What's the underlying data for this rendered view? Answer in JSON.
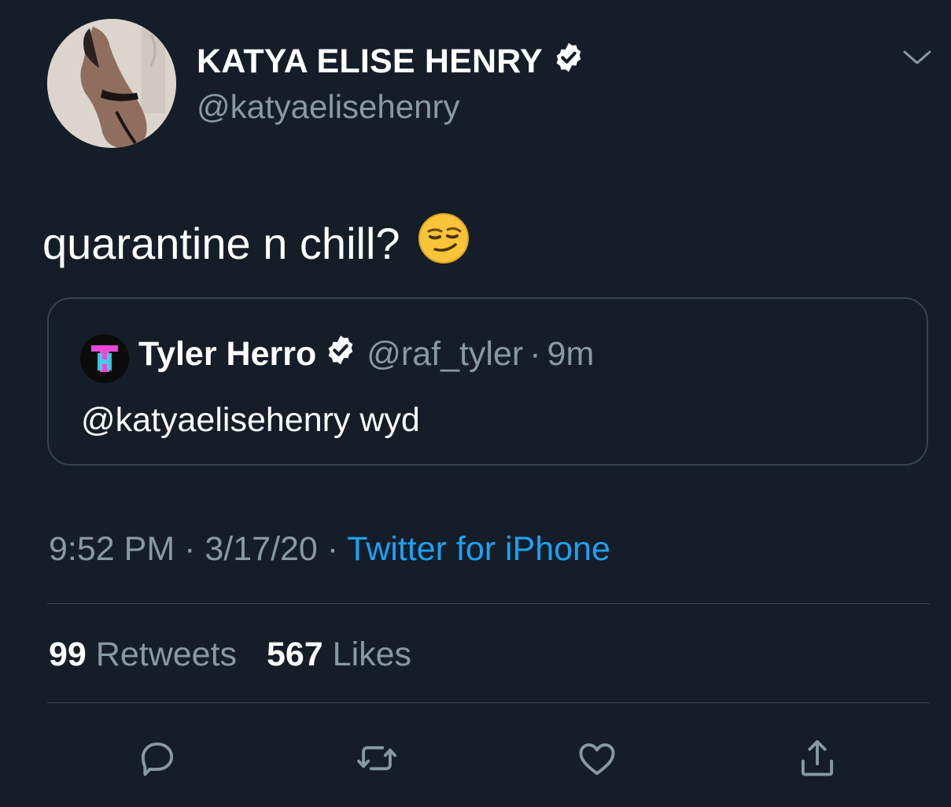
{
  "tweet": {
    "author": {
      "display_name": "KATYA ELISE HENRY",
      "handle": "@katyaelisehenry",
      "verified": true
    },
    "text": "quarantine n chill?",
    "emoji": "smirking-face",
    "quoted": {
      "display_name": "Tyler Herro",
      "handle": "@raf_tyler",
      "separator": "·",
      "time": "9m",
      "text": "@katyaelisehenry wyd"
    },
    "meta": {
      "time": "9:52 PM",
      "date": "3/17/20",
      "separator": "·",
      "source": "Twitter for iPhone"
    },
    "stats": {
      "retweets_count": "99",
      "retweets_label": "Retweets",
      "likes_count": "567",
      "likes_label": "Likes"
    },
    "actions": [
      "reply-icon",
      "retweet-icon",
      "like-icon",
      "share-icon"
    ]
  },
  "colors": {
    "background": "#151d28",
    "secondary_text": "#8899a6",
    "link": "#1da1f2",
    "border": "#38444d"
  }
}
